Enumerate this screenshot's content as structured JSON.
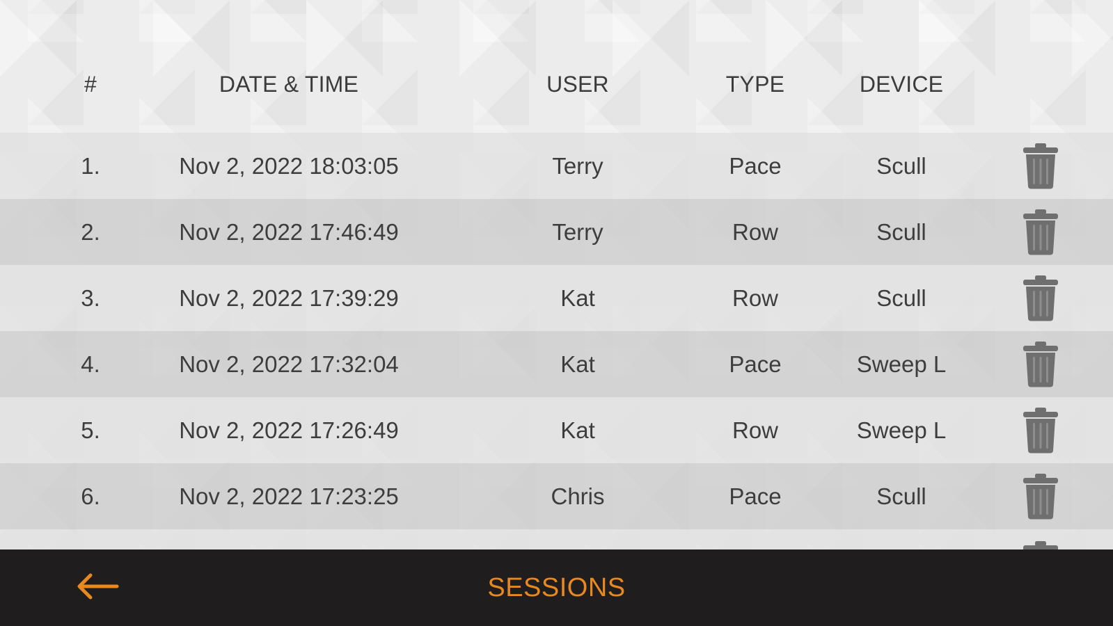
{
  "header": {
    "num": "#",
    "date_time": "DATE & TIME",
    "user": "USER",
    "type": "TYPE",
    "device": "DEVICE"
  },
  "sessions": [
    {
      "index": "1.",
      "date_time": "Nov 2, 2022 18:03:05",
      "user": "Terry",
      "type": "Pace",
      "device": "Scull",
      "delete_icon": "trash-icon"
    },
    {
      "index": "2.",
      "date_time": "Nov 2, 2022 17:46:49",
      "user": "Terry",
      "type": "Row",
      "device": "Scull",
      "delete_icon": "trash-icon"
    },
    {
      "index": "3.",
      "date_time": "Nov 2, 2022 17:39:29",
      "user": "Kat",
      "type": "Row",
      "device": "Scull",
      "delete_icon": "trash-icon"
    },
    {
      "index": "4.",
      "date_time": "Nov 2, 2022 17:32:04",
      "user": "Kat",
      "type": "Pace",
      "device": "Sweep L",
      "delete_icon": "trash-icon"
    },
    {
      "index": "5.",
      "date_time": "Nov 2, 2022 17:26:49",
      "user": "Kat",
      "type": "Row",
      "device": "Sweep L",
      "delete_icon": "trash-icon"
    },
    {
      "index": "6.",
      "date_time": "Nov 2, 2022 17:23:25",
      "user": "Chris",
      "type": "Pace",
      "device": "Scull",
      "delete_icon": "trash-icon"
    }
  ],
  "bottom_bar": {
    "title": "SESSIONS",
    "back_icon": "arrow-left-icon"
  },
  "colors": {
    "accent": "#e8891f",
    "bar_background": "#1f1d1e",
    "text": "#3d3d3d",
    "trash_icon": "#6f6f6f"
  }
}
